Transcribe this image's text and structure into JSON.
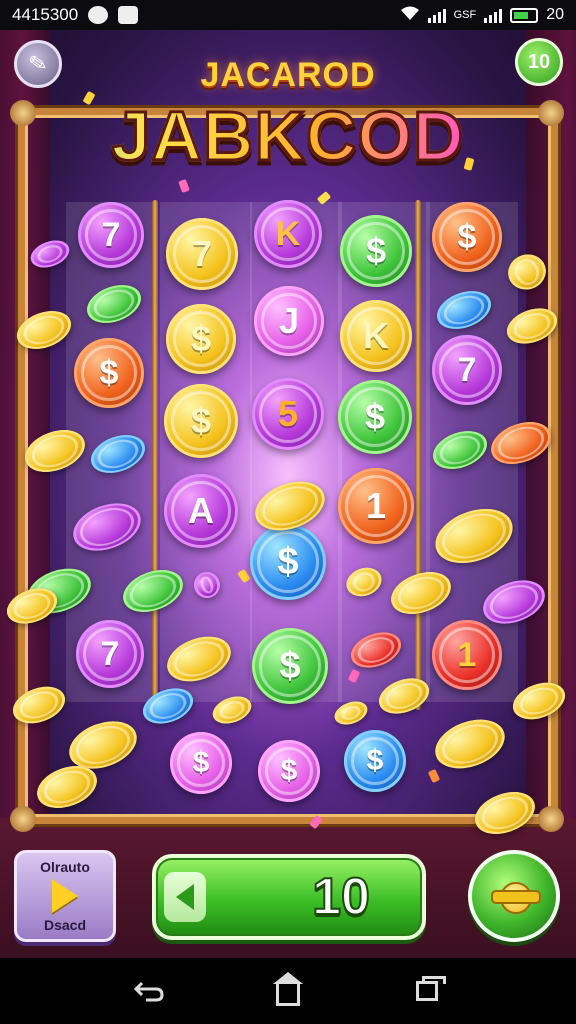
{
  "status_bar": {
    "time": "4415300",
    "network_label": "GSF",
    "battery_text": "20"
  },
  "game": {
    "title_top": "JACAROD",
    "title_main": "JABKCOD",
    "counter": "10",
    "play_panel": {
      "top_label": "Olrauto",
      "bottom_label": "Dsacd"
    },
    "bet_value": "10"
  },
  "icons": {
    "pen": "pen-icon",
    "play": "play-icon",
    "spin": "coin-spin-icon",
    "back": "back-icon",
    "home": "home-icon",
    "recents": "recents-icon"
  },
  "coins": [
    {
      "color": "purple",
      "symbol": "7"
    },
    {
      "color": "yellow",
      "symbol": "7"
    },
    {
      "color": "purple",
      "symbol": "K"
    },
    {
      "color": "green",
      "symbol": "$"
    },
    {
      "color": "orange",
      "symbol": "$"
    },
    {
      "color": "orange",
      "symbol": "$"
    },
    {
      "color": "yellow",
      "symbol": "$"
    },
    {
      "color": "pink",
      "symbol": "J"
    },
    {
      "color": "yellow",
      "symbol": "K"
    },
    {
      "color": "purple",
      "symbol": "7"
    },
    {
      "color": "yellow",
      "symbol": "$"
    },
    {
      "color": "purple",
      "symbol": "5"
    },
    {
      "color": "green",
      "symbol": "$"
    },
    {
      "color": "purple",
      "symbol": "A"
    },
    {
      "color": "orange",
      "symbol": "1"
    },
    {
      "color": "blue",
      "symbol": "$"
    },
    {
      "color": "purple",
      "symbol": "7"
    },
    {
      "color": "green",
      "symbol": "$"
    },
    {
      "color": "red",
      "symbol": "1"
    },
    {
      "color": "pink",
      "symbol": "$"
    },
    {
      "color": "pink",
      "symbol": "$"
    },
    {
      "color": "blue",
      "symbol": "$"
    }
  ],
  "accent_colors": {
    "frame_gold": "#c8853a",
    "bet_green": "#3cbf26",
    "title_yellow": "#ffd23a"
  }
}
